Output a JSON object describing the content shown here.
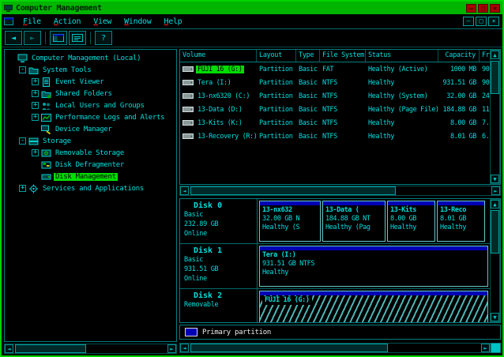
{
  "titlebar": {
    "title": "Computer Management"
  },
  "icons": {
    "up": "▲",
    "down": "▼",
    "left": "◄",
    "right": "►",
    "minimize": "–",
    "maximize": "□",
    "close": "×",
    "restore": "□",
    "help": "?"
  },
  "menu": {
    "items": [
      {
        "acc": "F",
        "rest": "ile"
      },
      {
        "acc": "A",
        "rest": "ction"
      },
      {
        "acc": "V",
        "rest": "iew"
      },
      {
        "acc": "W",
        "rest": "indow"
      },
      {
        "acc": "H",
        "rest": "elp"
      }
    ]
  },
  "tree": {
    "items": [
      {
        "label": "Computer Management (Local)",
        "expander": ""
      },
      {
        "label": "System Tools",
        "expander": "-"
      },
      {
        "label": "Event Viewer",
        "expander": "+"
      },
      {
        "label": "Shared Folders",
        "expander": "+"
      },
      {
        "label": "Local Users and Groups",
        "expander": "+"
      },
      {
        "label": "Performance Logs and Alerts",
        "expander": "+"
      },
      {
        "label": "Device Manager",
        "expander": ""
      },
      {
        "label": "Storage",
        "expander": "-"
      },
      {
        "label": "Removable Storage",
        "expander": "+"
      },
      {
        "label": "Disk Defragmenter",
        "expander": ""
      },
      {
        "label": "Disk Management",
        "expander": "",
        "selected": true
      },
      {
        "label": "Services and Applications",
        "expander": "+"
      }
    ]
  },
  "volumes": {
    "columns": [
      "Volume",
      "Layout",
      "Type",
      "File System",
      "Status",
      "Capacity",
      "Fr"
    ],
    "rows": [
      {
        "volume": "FUJI 16 (G:)",
        "layout": "Partition",
        "type": "Basic",
        "fs": "FAT",
        "status": "Healthy (Active)",
        "capacity": "1000 MB",
        "free": "90",
        "selected": true
      },
      {
        "volume": "Tera (I:)",
        "layout": "Partition",
        "type": "Basic",
        "fs": "NTFS",
        "status": "Healthy",
        "capacity": "931.51 GB",
        "free": "90"
      },
      {
        "volume": "13-nx6320 (C:)",
        "layout": "Partition",
        "type": "Basic",
        "fs": "NTFS",
        "status": "Healthy (System)",
        "capacity": "32.00 GB",
        "free": "24"
      },
      {
        "volume": "13-Data (D:)",
        "layout": "Partition",
        "type": "Basic",
        "fs": "NTFS",
        "status": "Healthy (Page File)",
        "capacity": "184.88 GB",
        "free": "11"
      },
      {
        "volume": "13-Kits (K:)",
        "layout": "Partition",
        "type": "Basic",
        "fs": "NTFS",
        "status": "Healthy",
        "capacity": "8.00 GB",
        "free": "7."
      },
      {
        "volume": "13-Recovery (R:)",
        "layout": "Partition",
        "type": "Basic",
        "fs": "NTFS",
        "status": "Healthy",
        "capacity": "8.01 GB",
        "free": "6."
      }
    ]
  },
  "disks": [
    {
      "name": "Disk 0",
      "desc1": "Basic",
      "desc2": "232.89 GB",
      "desc3": "Online",
      "partitions": [
        {
          "name": "13-nx632",
          "size": "32.00 GB N",
          "status": "Healthy (S"
        },
        {
          "name": "13-Data (",
          "size": "184.88 GB NT",
          "status": "Healthy (Pag"
        },
        {
          "name": "13-Kits",
          "size": "8.00 GB",
          "status": "Healthy"
        },
        {
          "name": "13-Reco",
          "size": "8.01 GB",
          "status": "Healthy"
        }
      ]
    },
    {
      "name": "Disk 1",
      "desc1": "Basic",
      "desc2": "931.51 GB",
      "desc3": "Online",
      "partitions": [
        {
          "name": "Tera (I:)",
          "size": "931.51 GB NTFS",
          "status": "Healthy"
        }
      ]
    },
    {
      "name": "Disk 2",
      "desc1": "Removable",
      "desc2": "",
      "desc3": "",
      "partitions": [
        {
          "name": "FUJI 16 (G:)",
          "size": "",
          "status": "",
          "hatched": true
        }
      ]
    }
  ],
  "legend": {
    "primary": "Primary partition"
  }
}
